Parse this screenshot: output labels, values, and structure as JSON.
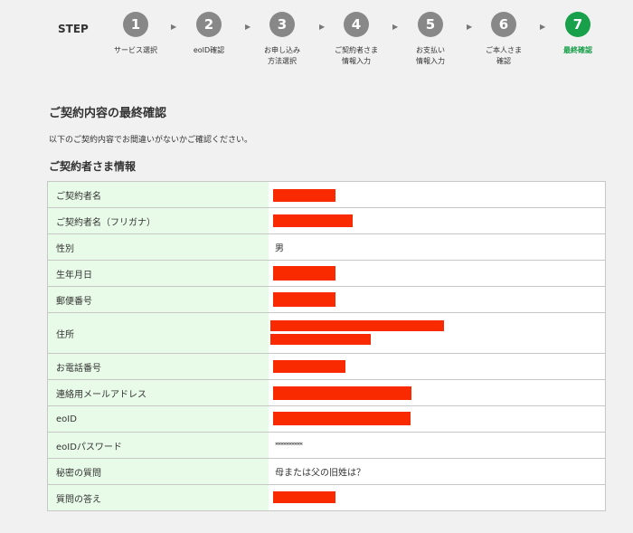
{
  "steps": {
    "heading": "STEP",
    "items": [
      {
        "num": "1",
        "label": "サービス選択",
        "active": false
      },
      {
        "num": "2",
        "label": "eoID確認",
        "active": false
      },
      {
        "num": "3",
        "label": "お申し込み\n方法選択",
        "active": false
      },
      {
        "num": "4",
        "label": "ご契約者さま\n情報入力",
        "active": false
      },
      {
        "num": "5",
        "label": "お支払い\n情報入力",
        "active": false
      },
      {
        "num": "6",
        "label": "ご本人さま\n確認",
        "active": false
      },
      {
        "num": "7",
        "label": "最終確認",
        "active": true
      }
    ]
  },
  "page": {
    "title": "ご契約内容の最終確認",
    "intro": "以下のご契約内容でお間違いがないかご確認ください。",
    "section_title": "ご契約者さま情報"
  },
  "table": {
    "rows": [
      {
        "label": "ご契約者名",
        "value": ""
      },
      {
        "label": "ご契約者名（フリガナ）",
        "value": ""
      },
      {
        "label": "性別",
        "value": "男"
      },
      {
        "label": "生年月日",
        "value": ""
      },
      {
        "label": "郵便番号",
        "value": ""
      },
      {
        "label": "住所",
        "value": ""
      },
      {
        "label": "お電話番号",
        "value": ""
      },
      {
        "label": "連絡用メールアドレス",
        "value": ""
      },
      {
        "label": "eoID",
        "value": ""
      },
      {
        "label": "eoIDパスワード",
        "value": "**********"
      },
      {
        "label": "秘密の質問",
        "value": "母または父の旧姓は？"
      },
      {
        "label": "質問の答え",
        "value": ""
      }
    ]
  },
  "colors": {
    "active_step": "#18a04a",
    "inactive_step": "#888888",
    "label_bg": "#e8fbe8",
    "redaction": "#fa2a00"
  }
}
